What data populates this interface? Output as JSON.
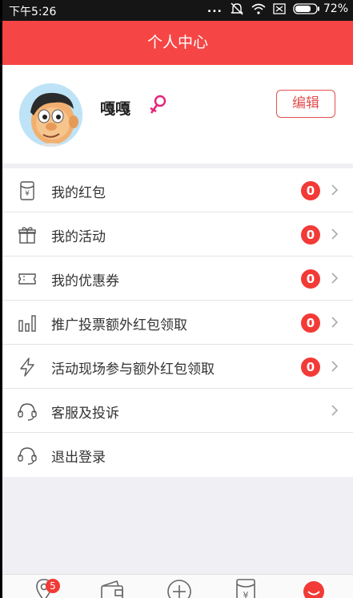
{
  "status_bar": {
    "time": "下午5:26",
    "dots": "...",
    "battery": "72%"
  },
  "header": {
    "title": "个人中心"
  },
  "profile": {
    "username": "嘎嘎",
    "gender": "female",
    "edit_label": "编辑"
  },
  "menu": {
    "items": [
      {
        "label": "我的红包",
        "badge": "0",
        "icon": "red-packet-icon"
      },
      {
        "label": "我的活动",
        "badge": "0",
        "icon": "gift-icon"
      },
      {
        "label": "我的优惠券",
        "badge": "0",
        "icon": "coupon-icon"
      },
      {
        "label": "推广投票额外红包领取",
        "badge": "0",
        "icon": "bar-chart-icon"
      },
      {
        "label": "活动现场参与额外红包领取",
        "badge": "0",
        "icon": "lightning-icon"
      },
      {
        "label": "客服及投诉",
        "icon": "headset-icon"
      },
      {
        "label": "退出登录",
        "icon": "headset-icon"
      }
    ]
  },
  "bottom_nav": {
    "location_badge": "5",
    "tabs": [
      "location-icon",
      "wallet-icon",
      "add-icon",
      "red-packet-icon",
      "profile-icon"
    ]
  },
  "colors": {
    "accent": "#f64545",
    "badge": "#f23a36"
  }
}
